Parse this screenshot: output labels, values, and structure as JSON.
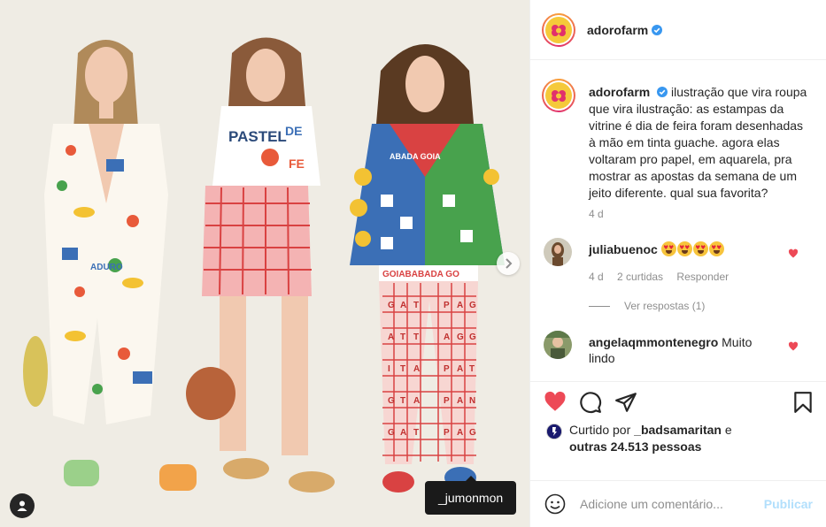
{
  "post": {
    "username": "adorofarm",
    "verified": true,
    "caption": "ilustração que vira roupa que vira ilustração: as estampas da vitrine é dia de feira foram desenhadas à mão em tinta guache. agora elas voltaram pro papel, em aquarela, pra mostrar as apostas da semana de um jeito diferente. qual sua favorita?",
    "caption_time": "4 d",
    "image_tag": "_jumonmon",
    "artwork_prints": {
      "shirt_line1": "PASTEL",
      "shirt_line2": "DE",
      "shirt_line3": "FE",
      "jumpsuit_label": "ADURO",
      "jacket_label": "ABADA GOIA",
      "belt_label": "GOIABABADA GO",
      "pants_letters": [
        "G",
        "A",
        "T",
        "P",
        "A",
        "G",
        "A",
        "T",
        "T",
        "A",
        "G",
        "G",
        "I",
        "T",
        "A",
        "P",
        "A",
        "T",
        "G",
        "T",
        "A",
        "P",
        "A",
        "N",
        "G",
        "A",
        "T",
        "P",
        "A",
        "G"
      ]
    }
  },
  "comments": [
    {
      "username": "juliabuenoc",
      "text": "",
      "emoji_count": 4,
      "time": "4 d",
      "likes": "2 curtidas",
      "reply": "Responder",
      "view_replies": "Ver respostas (1)"
    },
    {
      "username": "angelaqmmontenegro",
      "text": "Muito lindo"
    }
  ],
  "likes": {
    "prefix": "Curtido por",
    "user": "_badsamaritan",
    "joiner": "e",
    "others": "outras 24.513 pessoas"
  },
  "composer": {
    "placeholder": "Adicione um comentário...",
    "publish_label": "Publicar"
  },
  "colors": {
    "like_red": "#ed4956",
    "link_blue": "#0095f6",
    "publish_disabled": "#b2dffc",
    "verified_blue": "#3897f0"
  }
}
